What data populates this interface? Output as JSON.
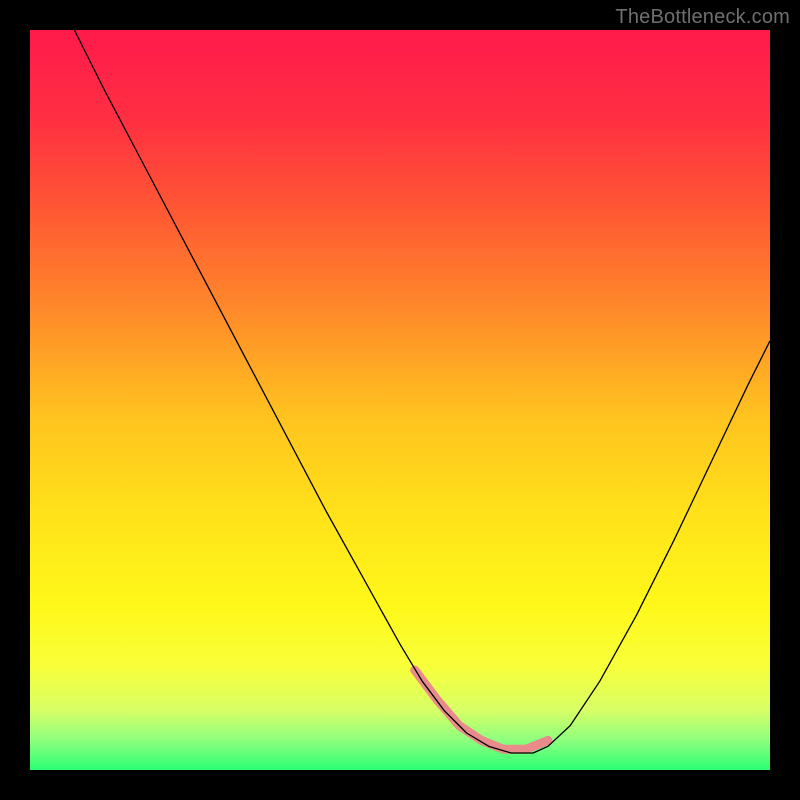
{
  "watermark": "TheBottleneck.com",
  "chart_data": {
    "type": "line",
    "title": "",
    "xlabel": "",
    "ylabel": "",
    "xlim": [
      0,
      100
    ],
    "ylim": [
      0,
      100
    ],
    "background_gradient": {
      "stops": [
        {
          "offset": 0.0,
          "color": "#ff1a4b"
        },
        {
          "offset": 0.12,
          "color": "#ff2f42"
        },
        {
          "offset": 0.25,
          "color": "#ff5a33"
        },
        {
          "offset": 0.38,
          "color": "#ff8a2a"
        },
        {
          "offset": 0.52,
          "color": "#ffc21f"
        },
        {
          "offset": 0.66,
          "color": "#ffe31a"
        },
        {
          "offset": 0.78,
          "color": "#fff81a"
        },
        {
          "offset": 0.86,
          "color": "#f8ff3a"
        },
        {
          "offset": 0.92,
          "color": "#d6ff66"
        },
        {
          "offset": 0.96,
          "color": "#8dff7e"
        },
        {
          "offset": 1.0,
          "color": "#2bff74"
        }
      ]
    },
    "series": [
      {
        "name": "curve",
        "color": "#000000",
        "stroke_width": 1.3,
        "x": [
          6,
          10,
          15,
          20,
          25,
          30,
          35,
          40,
          45,
          50,
          53,
          56,
          59,
          62,
          65,
          68,
          70,
          73,
          77,
          82,
          87,
          92,
          97,
          100
        ],
        "values": [
          100,
          92,
          82.5,
          73,
          63.5,
          54,
          44.5,
          35,
          26,
          17,
          12,
          8,
          5,
          3.2,
          2.3,
          2.3,
          3.2,
          6,
          12,
          21,
          31,
          41.5,
          52,
          58
        ]
      },
      {
        "name": "highlight",
        "color": "#e98b8b",
        "stroke_width": 9,
        "linecap": "round",
        "x": [
          52,
          55,
          58,
          61,
          64,
          67,
          70,
          72,
          74
        ],
        "values": [
          13.5,
          9.5,
          6,
          4,
          2.8,
          2.8,
          4,
          6,
          8.5
        ]
      }
    ],
    "highlight_gap": {
      "x": 72.5,
      "width": 1.4
    }
  }
}
